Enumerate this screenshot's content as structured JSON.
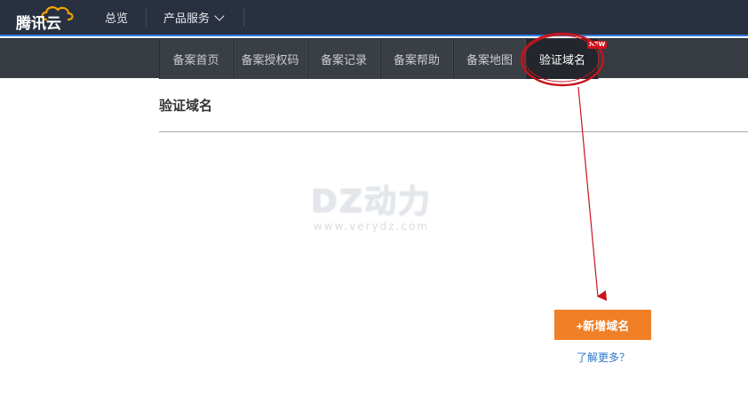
{
  "header": {
    "logo_text": "腾讯云",
    "nav": {
      "overview": "总览",
      "products": "产品服务"
    }
  },
  "subnav": {
    "tabs": [
      {
        "label": "备案首页"
      },
      {
        "label": "备案授权码"
      },
      {
        "label": "备案记录"
      },
      {
        "label": "备案帮助"
      },
      {
        "label": "备案地图"
      },
      {
        "label": "验证域名",
        "active": true
      }
    ],
    "badge": "NEW"
  },
  "main": {
    "title": "验证域名",
    "add_button": "+新增域名",
    "learn_more": "了解更多？"
  },
  "watermark": {
    "main": "DZ动力",
    "sub": "www.verydz.com"
  },
  "colors": {
    "topbar": "#293040",
    "accent_line": "#2d7fe0",
    "subnav": "#373b42",
    "button": "#f07f26",
    "link": "#2b77c7",
    "annotation": "#c8141c"
  },
  "icons": {
    "logo": "cloud-logo-icon",
    "dropdown": "chevron-down-icon"
  }
}
